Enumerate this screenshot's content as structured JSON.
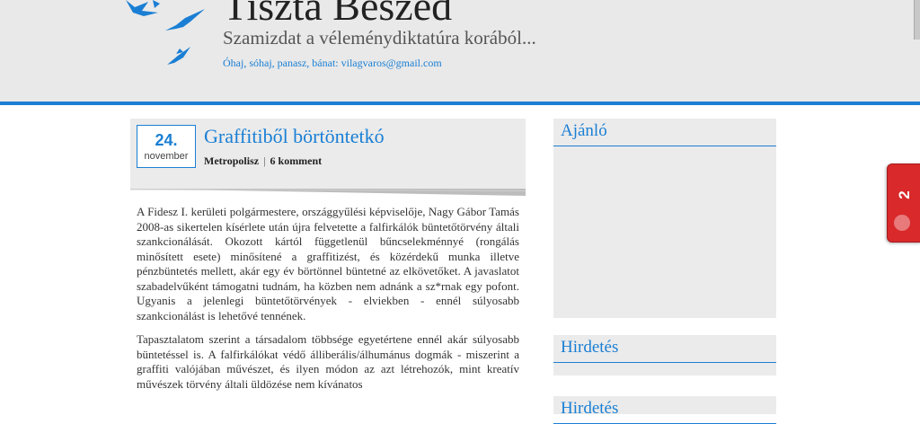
{
  "header": {
    "title": "Tiszta Beszéd",
    "tagline": "Szamizdat a véleménydiktatúra korából...",
    "contact": "Óhaj, sóhaj, panasz, bánat: vilagvaros@gmail.com"
  },
  "post": {
    "date_day": "24.",
    "date_month": "november",
    "title": "Graffitiből börtöntetkó",
    "author": "Metropolisz",
    "comments": "6 komment",
    "paragraphs": [
      " A Fidesz I. kerületi polgármestere, országgyűlési képviselője, Nagy Gábor Tamás 2008-as sikertelen kísérlete után újra felvetette a falfirkálók büntetőtörvény általi szankcionálását. Okozott kártól függetlenül bűncselekménnyé (rongálás minősített esete) minősítené a graffitizést, és közérdekű munka illetve pénzbüntetés mellett, akár egy év börtönnel büntetné az elkövetőket. A javaslatot szabadelvűként támogatni tudnám, ha közben nem adnánk a sz*rnak egy pofont. Ugyanis a jelenlegi büntetőtörvények - elviekben - ennél súlyosabb szankcionálást is lehetővé tennének.",
      "Tapasztalatom szerint a társadalom többsége egyetértene ennél akár súlyosabb büntetéssel is. A falfirkálókat védő álliberális/álhumánus dogmák - miszerint a graffiti valójában művészet, és ilyen módon az azt létrehozók, mint kreatív művészek törvény általi üldözése nem kívánatos"
    ]
  },
  "sidebar": {
    "widgets": [
      {
        "title": "Ajánló"
      },
      {
        "title": "Hirdetés"
      },
      {
        "title": "Hirdetés"
      }
    ]
  },
  "notification": {
    "count": "2"
  },
  "colors": {
    "accent": "#1a7fd4",
    "header_bg": "#e9e9e9",
    "badge": "#d9292b"
  },
  "icons": {
    "birds": "birds-logo-icon",
    "badge_icon": "share-icon"
  }
}
